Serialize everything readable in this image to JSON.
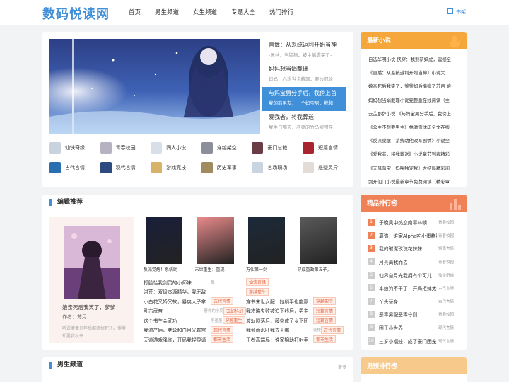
{
  "header": {
    "logo": "数码悦读网",
    "nav": [
      "首页",
      "男生频道",
      "女生频道",
      "专题大全",
      "热门排行"
    ],
    "shelf": "书架"
  },
  "slides": [
    {
      "title": "直播：从系统返利开始当神",
      "desc": "-屌丝，当舔狗，被主播虐哭了-"
    },
    {
      "title": "妈妈想当娟戴珊",
      "desc": "妈妈一心想当卡戴珊，要炒冠轮"
    },
    {
      "title": "与妈宝男分手后，我傍上首",
      "desc": "我的前男友，一个妈宝男，我和"
    },
    {
      "title": "爱我者，将我葬送",
      "desc": "我生日那天，老婆的竹马被困在"
    }
  ],
  "categories": [
    {
      "label": "仙侠奇缘",
      "color": "#c9d3de"
    },
    {
      "label": "青春校园",
      "color": "#b7b2c2"
    },
    {
      "label": "同人小说",
      "color": "#d9dfe8"
    },
    {
      "label": "穿越架空",
      "color": "#8a8f99"
    },
    {
      "label": "豪门总裁",
      "color": "#6b3b46"
    },
    {
      "label": "短篇言情",
      "color": "#a8242f"
    },
    {
      "label": "古代言情",
      "color": "#2a6fb0"
    },
    {
      "label": "现代言情",
      "color": "#2c4a80"
    },
    {
      "label": "游戏竞技",
      "color": "#d9b26a"
    },
    {
      "label": "历史军事",
      "color": "#a08a60"
    },
    {
      "label": "官场职场",
      "color": "#c8d4e0"
    },
    {
      "label": "悬疑灵异",
      "color": "#e3dcd6"
    }
  ],
  "editor": {
    "title": "编辑推荐",
    "featured": {
      "title": "娘亲死后我笑了，爹爹",
      "author": "作者：苏月",
      "desc": "听说爹爹几年后那酒掉死了。爹爹却要我秋来"
    },
    "covers": [
      {
        "name": "反派觉醒！系统助",
        "color": "#1a1f3a"
      },
      {
        "name": "末世重生：重现",
        "color": "#e98a8a"
      },
      {
        "name": "万仙第一剑",
        "color": "#1c2a3a"
      },
      {
        "name": "穿成重政第五子，",
        "color": "#5a5a5a"
      }
    ],
    "list": [
      {
        "title": "打脸恰我剑灵的小师妹",
        "tag": "",
        "author": "飘"
      },
      {
        "title": "",
        "tag": "仙侠奇缘",
        "author": ""
      },
      {
        "title": "洪荒：双级本源精华，我无敌",
        "tag": "",
        "author": ""
      },
      {
        "title": "",
        "tag": "穿越重生",
        "author": ""
      },
      {
        "title": "小白花又娇又软，暴戾太子拿",
        "tag": "古代言情",
        "author": ""
      },
      {
        "title": "穿书末世女配：她躺平也能赢",
        "tag": "穿越架空",
        "author": ""
      },
      {
        "title": "乱古武帝",
        "tag": "玄幻科幻",
        "author": "曹你的小屁"
      },
      {
        "title": "我攻略失败被迫下线后，男主",
        "tag": "短篇言情",
        "author": ""
      },
      {
        "title": "这个书生会武功",
        "tag": "穿越重生",
        "author": "李墨墨"
      },
      {
        "title": "渡劫陨落后，藤帝成了乡下团",
        "tag": "短篇言情",
        "author": ""
      },
      {
        "title": "我流产后，老公和白月光普宫",
        "tag": "现代言情",
        "author": ""
      },
      {
        "title": "我到雨水吓我去天都",
        "tag": "古代言情",
        "author": "蓬楼"
      },
      {
        "title": "天道游戏降临，开局我捏界请",
        "tag": "都市生活",
        "author": ""
      },
      {
        "title": "王者高端局：谁家锦助打射手",
        "tag": "都市生活",
        "author": ""
      }
    ]
  },
  "boys": {
    "title": "男生频道",
    "more": "更多"
  },
  "newest": {
    "title": "最新小说",
    "items": [
      "自选华明小说 快穿：我到新妖虎，震撼全",
      "《直播：从系统返利开始当神》小说大",
      "娘亲死后我笑了，爹爹却后悔疯了苏月 娘",
      "妈妈想当娟戴珊小说完整版在线阅读（主",
      "云芷郡辞小说 《与妈宝男分手后，我傍上",
      "《公主不想要男主》林清雪沈印全文在线",
      "《反派觉醒！系统助他改写剧情》小说全",
      "《爱我者，将我葬送》小说章节列表精彩",
      "《天降萌宝，妈咪独宠我》大结局精彩阅",
      "剑开仙门小说最新章节免费阅读（精彩章"
    ]
  },
  "ranking": {
    "title": "精品排行榜",
    "items": [
      {
        "title": "于晚风中热恋南幕林朝",
        "cat": "青春校园"
      },
      {
        "title": "离谱，谁家Alpha吃小蛋糕啊",
        "cat": "青春校园"
      },
      {
        "title": "我的璀璨玫瑰花妹妹",
        "cat": "短篇言情"
      },
      {
        "title": "月亮离我而去",
        "cat": "青春校园"
      },
      {
        "title": "仙界自月光我拥有个可儿",
        "cat": "仙侠奇缘"
      },
      {
        "title": "本娘狗不干了！开局拒嫁太子",
        "cat": "古代言情"
      },
      {
        "title": "丫头替身",
        "cat": "古代言情"
      },
      {
        "title": "恶毒男配恶毒守则",
        "cat": "青春校园"
      },
      {
        "title": "困于小世界",
        "cat": "现代言情"
      },
      {
        "title": "三岁小福娃，成了豪门团宠",
        "cat": "现代言情"
      }
    ]
  },
  "boysRank": {
    "title": "男频排行榜"
  },
  "colors": {
    "brand": "#3f8fd9",
    "newestHead": "#f5a73b",
    "rankHead": "#f08056",
    "boysRankHead": "#f7c98a"
  }
}
